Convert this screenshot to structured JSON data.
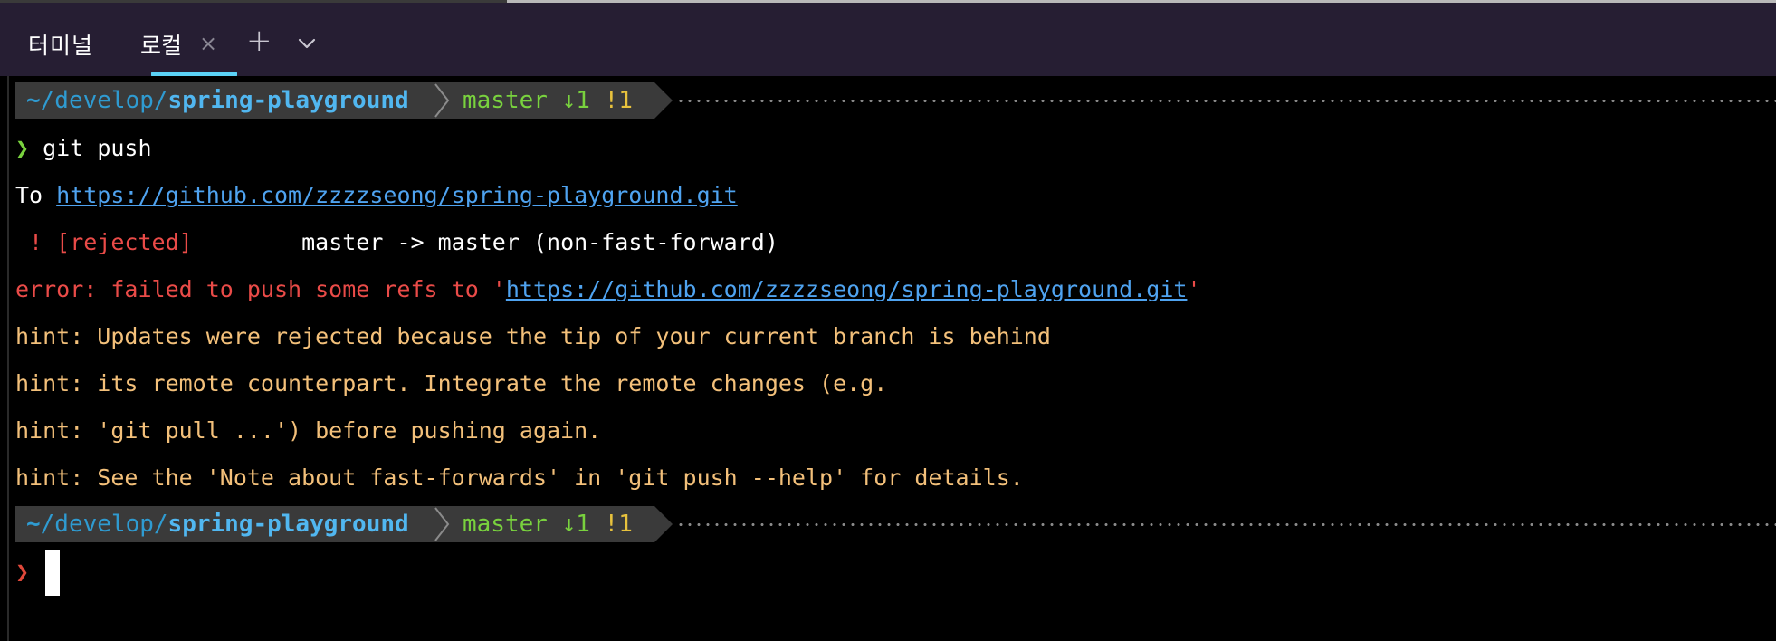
{
  "tabbar": {
    "title": "터미널",
    "active_tab": "로컬",
    "close_glyph": "×",
    "add_glyph": "+",
    "dropdown_icon": "chevron-down-icon",
    "accent_color": "#5bd2f6",
    "background_color": "#261e33"
  },
  "prompt": {
    "path_prefix": "~/develop/",
    "path_tilde": "~",
    "path_mid": "/develop/",
    "repo": "spring-playground",
    "branch": "master",
    "behind": "↓1",
    "modified": "!1",
    "chevron": "❯"
  },
  "output": {
    "command": "git push",
    "to_label": "To ",
    "remote_url": "https://github.com/zzzzseong/spring-playground.git",
    "rejected_status": " ! [rejected]",
    "rejected_refs": "master -> master (non-fast-forward)",
    "error_prefix": "error: failed to push some refs to '",
    "error_url": "https://github.com/zzzzseong/spring-playground.git",
    "error_suffix": "'",
    "hints": [
      "hint: Updates were rejected because the tip of your current branch is behind",
      "hint: its remote counterpart. Integrate the remote changes (e.g.",
      "hint: 'git pull ...') before pushing again.",
      "hint: See the 'Note about fast-forwards' in 'git push --help' for details."
    ]
  },
  "colors": {
    "success_chevron": "#79d23e",
    "error_chevron": "#e0483a",
    "error_text": "#ea4b48",
    "hint_text": "#f3c07a",
    "link": "#4fa3f0"
  }
}
